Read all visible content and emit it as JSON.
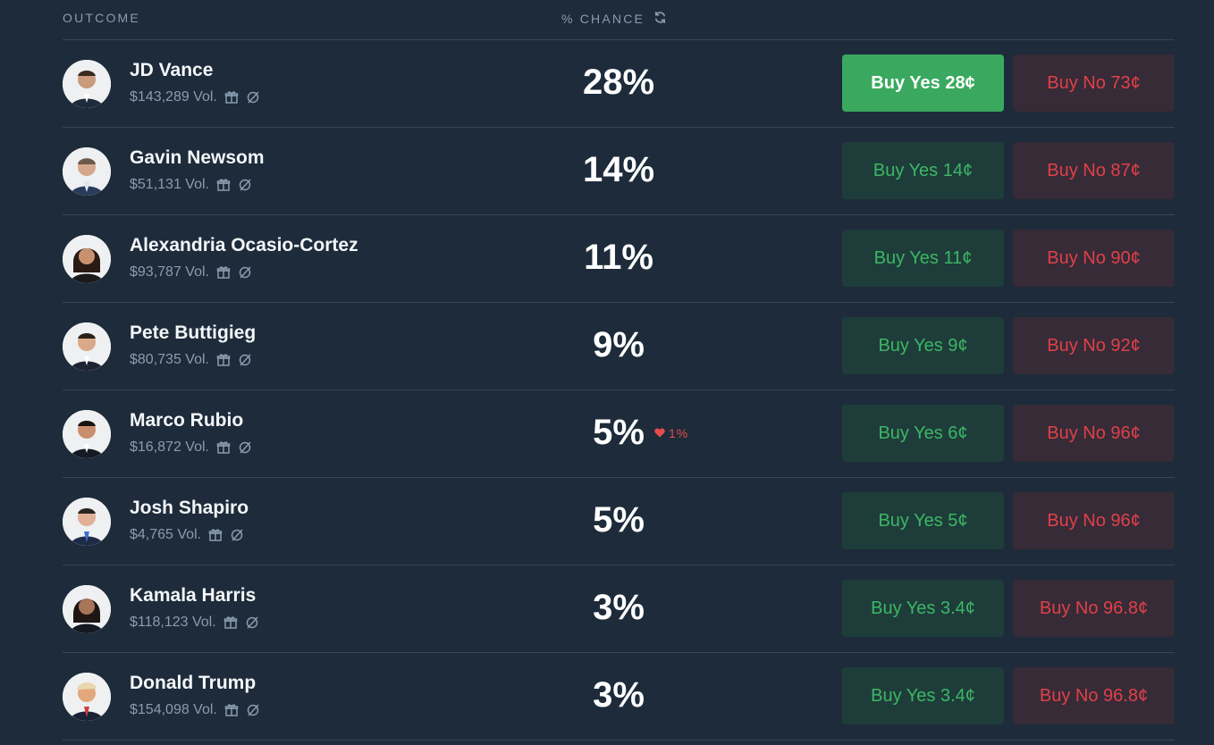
{
  "header": {
    "outcome_label": "OUTCOME",
    "chance_label": "% CHANCE"
  },
  "colors": {
    "background": "#1d2b3a",
    "yes_active": "#3aa95f",
    "yes_text": "#3cb665",
    "no_text": "#e0404a",
    "muted": "#8a9cb0"
  },
  "icons": [
    "refresh-icon",
    "gift-icon",
    "no-cash-icon",
    "heart-icon"
  ],
  "outcomes": [
    {
      "name": "JD Vance",
      "volume": "$143,289 Vol.",
      "chance": "28%",
      "change": "",
      "buy_yes": "Buy Yes 28¢",
      "buy_no": "Buy No 73¢"
    },
    {
      "name": "Gavin Newsom",
      "volume": "$51,131 Vol.",
      "chance": "14%",
      "change": "",
      "buy_yes": "Buy Yes 14¢",
      "buy_no": "Buy No 87¢"
    },
    {
      "name": "Alexandria Ocasio-Cortez",
      "volume": "$93,787 Vol.",
      "chance": "11%",
      "change": "",
      "buy_yes": "Buy Yes 11¢",
      "buy_no": "Buy No 90¢"
    },
    {
      "name": "Pete Buttigieg",
      "volume": "$80,735 Vol.",
      "chance": "9%",
      "change": "",
      "buy_yes": "Buy Yes 9¢",
      "buy_no": "Buy No 92¢"
    },
    {
      "name": "Marco Rubio",
      "volume": "$16,872 Vol.",
      "chance": "5%",
      "change": "1%",
      "buy_yes": "Buy Yes 6¢",
      "buy_no": "Buy No 96¢"
    },
    {
      "name": "Josh Shapiro",
      "volume": "$4,765 Vol.",
      "chance": "5%",
      "change": "",
      "buy_yes": "Buy Yes 5¢",
      "buy_no": "Buy No 96¢"
    },
    {
      "name": "Kamala Harris",
      "volume": "$118,123 Vol.",
      "chance": "3%",
      "change": "",
      "buy_yes": "Buy Yes 3.4¢",
      "buy_no": "Buy No 96.8¢"
    },
    {
      "name": "Donald Trump",
      "volume": "$154,098 Vol.",
      "chance": "3%",
      "change": "",
      "buy_yes": "Buy Yes 3.4¢",
      "buy_no": "Buy No 96.8¢"
    }
  ]
}
